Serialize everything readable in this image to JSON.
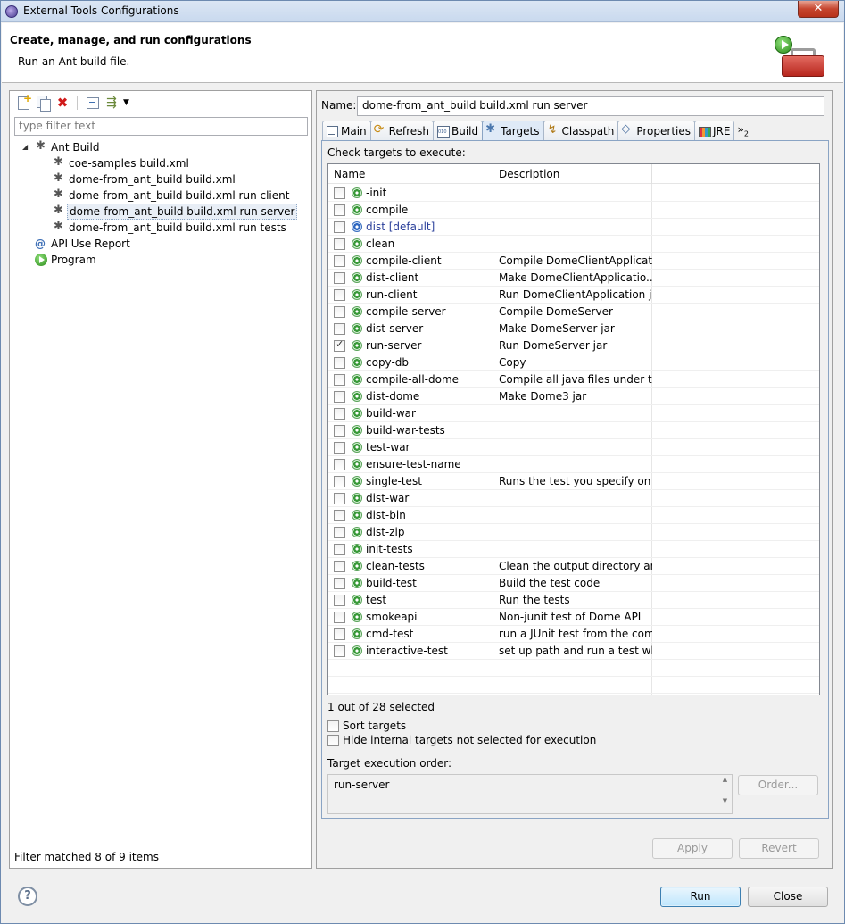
{
  "window": {
    "title": "External Tools Configurations"
  },
  "header": {
    "title": "Create, manage, and run configurations",
    "subtitle": "Run an Ant build file."
  },
  "left": {
    "toolbar": [
      "new-launch-config-icon",
      "duplicate-icon",
      "delete-icon",
      "collapse-all-icon",
      "filter-icon",
      "dropdown-icon"
    ],
    "filter_placeholder": "type filter text",
    "tree": [
      {
        "label": "Ant Build",
        "level": 0,
        "icon": "ant-icon",
        "expanded": true
      },
      {
        "label": "coe-samples build.xml",
        "level": 1,
        "icon": "ant-icon"
      },
      {
        "label": "dome-from_ant_build build.xml",
        "level": 1,
        "icon": "ant-icon"
      },
      {
        "label": "dome-from_ant_build build.xml run client",
        "level": 1,
        "icon": "ant-icon"
      },
      {
        "label": "dome-from_ant_build build.xml run server",
        "level": 1,
        "icon": "ant-icon",
        "selected": true
      },
      {
        "label": "dome-from_ant_build build.xml run tests",
        "level": 1,
        "icon": "ant-icon"
      },
      {
        "label": "API Use Report",
        "level": 0,
        "icon": "api-icon"
      },
      {
        "label": "Program",
        "level": 0,
        "icon": "program-icon"
      }
    ],
    "status": "Filter matched 8 of 9 items"
  },
  "right": {
    "name_label": "Name:",
    "name_value": "dome-from_ant_build build.xml run server",
    "tabs": [
      {
        "label": "Main",
        "icon": "main"
      },
      {
        "label": "Refresh",
        "icon": "refresh"
      },
      {
        "label": "Build",
        "icon": "build"
      },
      {
        "label": "Targets",
        "icon": "targets",
        "active": true
      },
      {
        "label": "Classpath",
        "icon": "classpath"
      },
      {
        "label": "Properties",
        "icon": "props"
      },
      {
        "label": "JRE",
        "icon": "jre"
      }
    ],
    "tabs_more": "»",
    "tabs_more_count": "2",
    "check_label": "Check targets to execute:",
    "columns": {
      "name": "Name",
      "description": "Description"
    },
    "targets": [
      {
        "name": "-init",
        "desc": "",
        "checked": false
      },
      {
        "name": "compile",
        "desc": "",
        "checked": false
      },
      {
        "name": "dist [default]",
        "desc": "",
        "checked": false,
        "default": true
      },
      {
        "name": "clean",
        "desc": "",
        "checked": false
      },
      {
        "name": "compile-client",
        "desc": "Compile DomeClientApplicat...",
        "checked": false
      },
      {
        "name": "dist-client",
        "desc": "Make DomeClientApplicatio...",
        "checked": false
      },
      {
        "name": "run-client",
        "desc": "Run DomeClientApplication jar",
        "checked": false
      },
      {
        "name": "compile-server",
        "desc": "Compile DomeServer",
        "checked": false
      },
      {
        "name": "dist-server",
        "desc": "Make DomeServer jar",
        "checked": false
      },
      {
        "name": "run-server",
        "desc": "Run DomeServer jar",
        "checked": true
      },
      {
        "name": "copy-db",
        "desc": "Copy",
        "checked": false
      },
      {
        "name": "compile-all-dome",
        "desc": "Compile all java files under t...",
        "checked": false
      },
      {
        "name": "dist-dome",
        "desc": "Make Dome3 jar",
        "checked": false
      },
      {
        "name": "build-war",
        "desc": "",
        "checked": false
      },
      {
        "name": "build-war-tests",
        "desc": "",
        "checked": false
      },
      {
        "name": "test-war",
        "desc": "",
        "checked": false
      },
      {
        "name": "ensure-test-name",
        "desc": "",
        "checked": false
      },
      {
        "name": "single-test",
        "desc": "Runs the test you specify on t...",
        "checked": false
      },
      {
        "name": "dist-war",
        "desc": "",
        "checked": false
      },
      {
        "name": "dist-bin",
        "desc": "",
        "checked": false
      },
      {
        "name": "dist-zip",
        "desc": "",
        "checked": false
      },
      {
        "name": "init-tests",
        "desc": "",
        "checked": false
      },
      {
        "name": "clean-tests",
        "desc": "Clean the output directory an...",
        "checked": false
      },
      {
        "name": "build-test",
        "desc": "Build the test code",
        "checked": false
      },
      {
        "name": "test",
        "desc": "Run the tests",
        "checked": false
      },
      {
        "name": "smokeapi",
        "desc": "Non-junit test of Dome API",
        "checked": false
      },
      {
        "name": "cmd-test",
        "desc": "run a JUnit test from the com...",
        "checked": false
      },
      {
        "name": "interactive-test",
        "desc": "set up path and run a test wh...",
        "checked": false
      }
    ],
    "selected_count": "1 out of 28 selected",
    "sort_targets": "Sort targets",
    "hide_internal": "Hide internal targets not selected for execution",
    "order_label": "Target execution order:",
    "order_value": "run-server",
    "order_button": "Order...",
    "apply_button": "Apply",
    "revert_button": "Revert"
  },
  "footer": {
    "run_button": "Run",
    "close_button": "Close",
    "help_icon": "?"
  }
}
